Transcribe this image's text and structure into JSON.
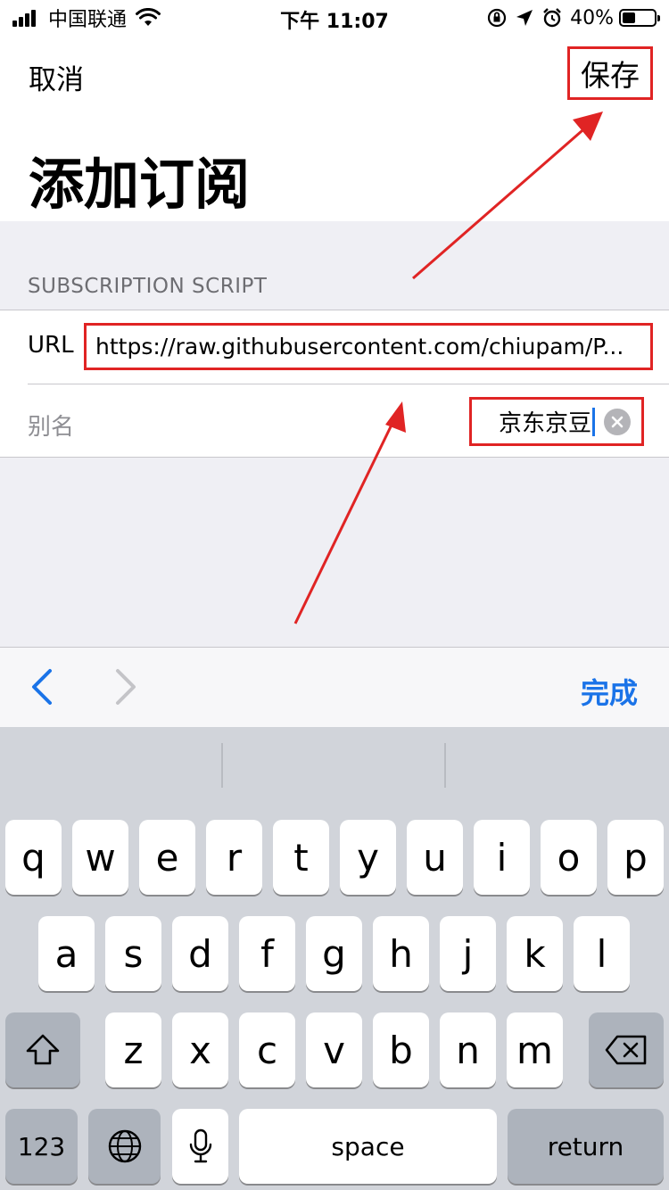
{
  "status_bar": {
    "carrier": "中国联通",
    "time": "下午 11:07",
    "battery_percent": "40%",
    "battery_level": 0.4,
    "icons": [
      "signal-icon",
      "wifi-icon",
      "orientation-lock-icon",
      "location-icon",
      "alarm-icon",
      "battery-icon"
    ]
  },
  "nav": {
    "cancel_label": "取消",
    "save_label": "保存"
  },
  "page_title": "添加订阅",
  "section": {
    "header": "SUBSCRIPTION SCRIPT",
    "url_label": "URL",
    "url_value": "https://raw.githubusercontent.com/chiupam/P...",
    "alias_label": "别名",
    "alias_value": "京东京豆"
  },
  "accessory": {
    "done_label": "完成",
    "accent_color": "#1a73e8"
  },
  "keyboard": {
    "row1": [
      "q",
      "w",
      "e",
      "r",
      "t",
      "y",
      "u",
      "i",
      "o",
      "p"
    ],
    "row2": [
      "a",
      "s",
      "d",
      "f",
      "g",
      "h",
      "j",
      "k",
      "l"
    ],
    "row3": [
      "z",
      "x",
      "c",
      "v",
      "b",
      "n",
      "m"
    ],
    "numbers_label": "123",
    "space_label": "space",
    "return_label": "return"
  },
  "annotation_color": "#e02424"
}
